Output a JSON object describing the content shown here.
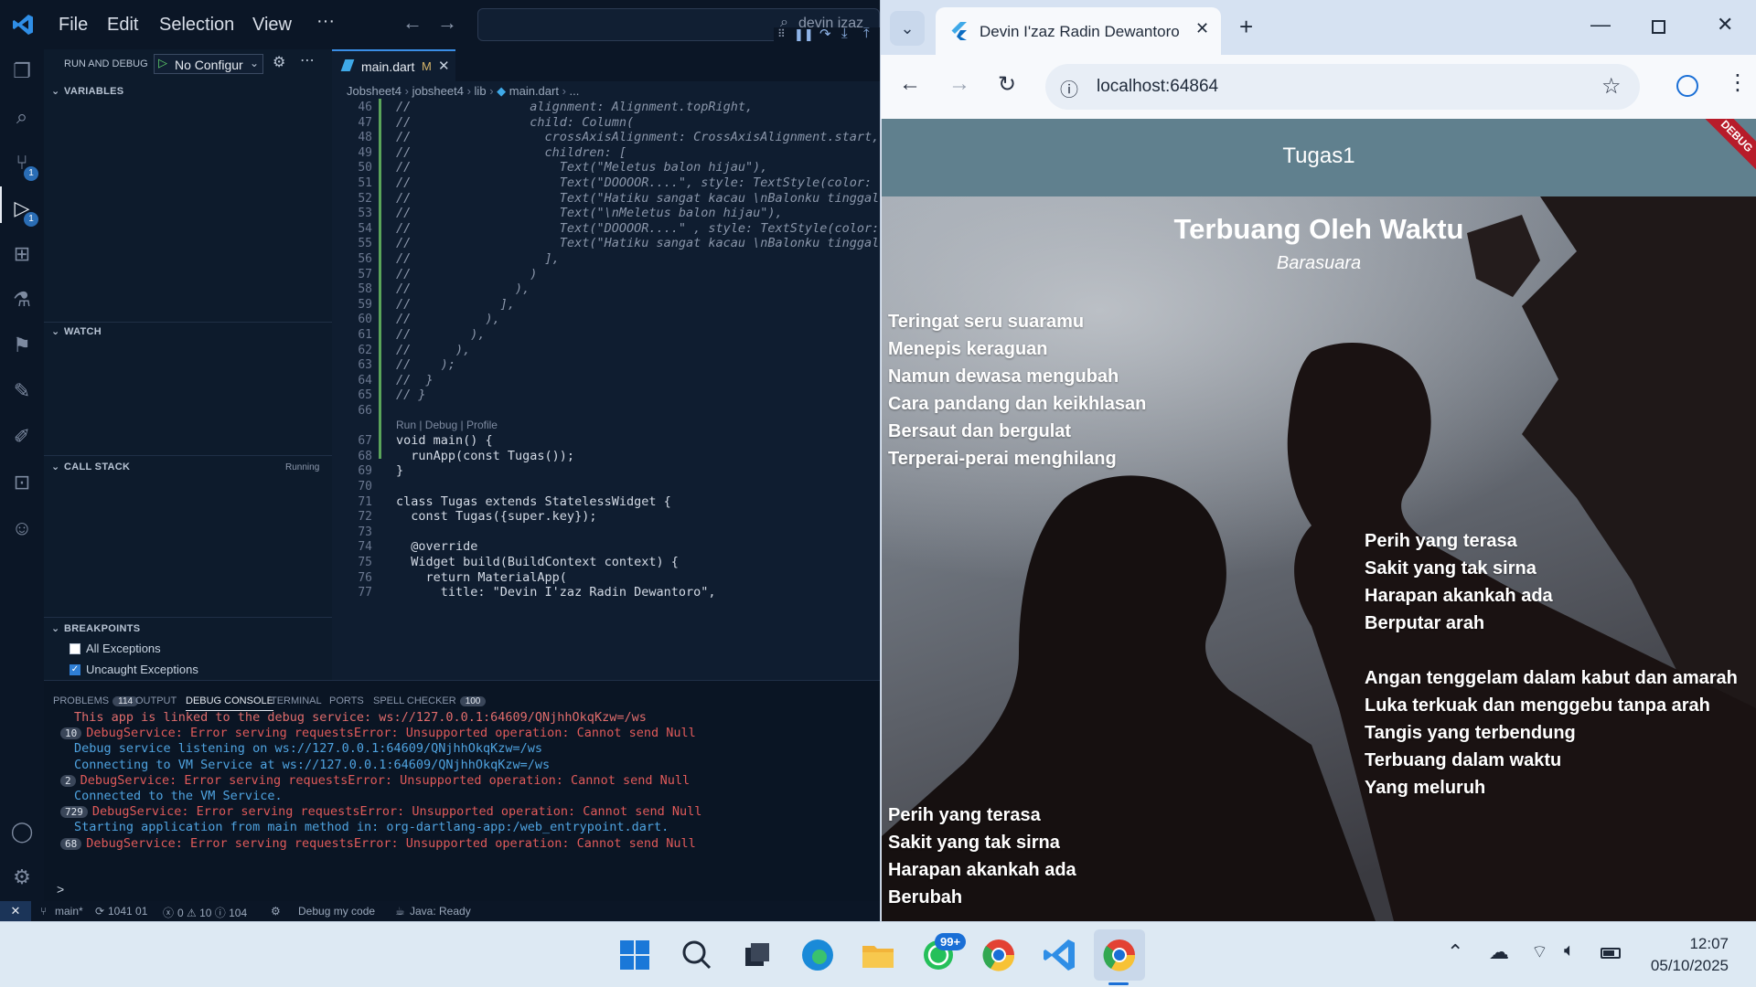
{
  "vscode": {
    "menu": [
      "File",
      "Edit",
      "Selection",
      "View",
      "···"
    ],
    "search_text": "devin izaz",
    "sidebar": {
      "run_debug_label": "RUN AND DEBUG",
      "config_select": "No Configur",
      "variables": "VARIABLES",
      "watch": "WATCH",
      "call_stack": "CALL STACK",
      "call_stack_status": "Running",
      "breakpoints": "BREAKPOINTS",
      "bp_all": "All Exceptions",
      "bp_uncaught": "Uncaught Exceptions"
    },
    "activity_badges": [
      "1",
      "1"
    ],
    "tab": {
      "label": "main.dart",
      "status": "M"
    },
    "breadcrumb": [
      "Jobsheet4",
      "jobsheet4",
      "lib",
      "main.dart",
      "..."
    ],
    "code_lines": [
      {
        "n": "46",
        "t": "//                alignment: Alignment.topRight,",
        "c": true
      },
      {
        "n": "47",
        "t": "//                child: Column(",
        "c": true
      },
      {
        "n": "48",
        "t": "//                  crossAxisAlignment: CrossAxisAlignment.start,",
        "c": true
      },
      {
        "n": "49",
        "t": "//                  children: [",
        "c": true
      },
      {
        "n": "50",
        "t": "//                    Text(\"Meletus balon hijau\"),",
        "c": true
      },
      {
        "n": "51",
        "t": "//                    Text(\"DOOOOR....\", style: TextStyle(color:",
        "c": true
      },
      {
        "n": "52",
        "t": "//                    Text(\"Hatiku sangat kacau \\nBalonku tinggal",
        "c": true
      },
      {
        "n": "53",
        "t": "//                    Text(\"\\nMeletus balon hijau\"),",
        "c": true
      },
      {
        "n": "54",
        "t": "//                    Text(\"DOOOOR....\" , style: TextStyle(color:",
        "c": true
      },
      {
        "n": "55",
        "t": "//                    Text(\"Hatiku sangat kacau \\nBalonku tinggal",
        "c": true
      },
      {
        "n": "56",
        "t": "//                  ],",
        "c": true
      },
      {
        "n": "57",
        "t": "//                )",
        "c": true
      },
      {
        "n": "58",
        "t": "//              ),",
        "c": true
      },
      {
        "n": "59",
        "t": "//            ],",
        "c": true
      },
      {
        "n": "60",
        "t": "//          ),",
        "c": true
      },
      {
        "n": "61",
        "t": "//        ),",
        "c": true
      },
      {
        "n": "62",
        "t": "//      ),",
        "c": true
      },
      {
        "n": "63",
        "t": "//    );",
        "c": true
      },
      {
        "n": "64",
        "t": "//  }",
        "c": true
      },
      {
        "n": "65",
        "t": "// }",
        "c": true
      },
      {
        "n": "66",
        "t": "",
        "c": false
      },
      {
        "n": "",
        "t": "Run | Debug | Profile",
        "c": false
      },
      {
        "n": "67",
        "t": "void main() {",
        "c": false
      },
      {
        "n": "68",
        "t": "  runApp(const Tugas());",
        "c": false
      },
      {
        "n": "69",
        "t": "}",
        "c": false
      },
      {
        "n": "70",
        "t": "",
        "c": false
      },
      {
        "n": "71",
        "t": "class Tugas extends StatelessWidget {",
        "c": false
      },
      {
        "n": "72",
        "t": "  const Tugas({super.key});",
        "c": false
      },
      {
        "n": "73",
        "t": "",
        "c": false
      },
      {
        "n": "74",
        "t": "  @override",
        "c": false
      },
      {
        "n": "75",
        "t": "  Widget build(BuildContext context) {",
        "c": false
      },
      {
        "n": "76",
        "t": "    return MaterialApp(",
        "c": false
      },
      {
        "n": "77",
        "t": "      title: \"Devin I'zaz Radin Dewantoro\",",
        "c": false
      }
    ],
    "panel_tabs": [
      {
        "label": "PROBLEMS",
        "badge": "114"
      },
      {
        "label": "OUTPUT",
        "badge": ""
      },
      {
        "label": "DEBUG CONSOLE",
        "badge": ""
      },
      {
        "label": "TERMINAL",
        "badge": ""
      },
      {
        "label": "PORTS",
        "badge": ""
      },
      {
        "label": "SPELL CHECKER",
        "badge": "100"
      }
    ],
    "console_lines": [
      {
        "badge": "",
        "text": "This app is linked to the debug service: ws://127.0.0.1:64609/QNjhhOkqKzw=/ws",
        "color": "#e06c6c"
      },
      {
        "badge": "10",
        "text": "DebugService: Error serving requestsError: Unsupported operation: Cannot send Null",
        "color": "#e05a5a"
      },
      {
        "badge": "",
        "text": "Debug service listening on ws://127.0.0.1:64609/QNjhhOkqKzw=/ws",
        "color": "#4fa3e0"
      },
      {
        "badge": "",
        "text": "Connecting to VM Service at ws://127.0.0.1:64609/QNjhhOkqKzw=/ws",
        "color": "#4fa3e0"
      },
      {
        "badge": "2",
        "text": "DebugService: Error serving requestsError: Unsupported operation: Cannot send Null",
        "color": "#e05a5a"
      },
      {
        "badge": "",
        "text": "Connected to the VM Service.",
        "color": "#4fa3e0"
      },
      {
        "badge": "729",
        "text": "DebugService: Error serving requestsError: Unsupported operation: Cannot send Null",
        "color": "#e05a5a"
      },
      {
        "badge": "",
        "text": "Starting application from main method in: org-dartlang-app:/web_entrypoint.dart.",
        "color": "#4fa3e0"
      },
      {
        "badge": "68",
        "text": "DebugService: Error serving requestsError: Unsupported operation: Cannot send Null",
        "color": "#e05a5a"
      }
    ],
    "console_prompt": ">",
    "status": {
      "branch": "main*",
      "sync": "1041 01",
      "problems": "0 ⚠ 10 ⓘ 104",
      "debug": "Debug my code",
      "java": "Java: Ready"
    }
  },
  "chrome": {
    "tab_title": "Devin I'zaz Radin Dewantoro",
    "url": "localhost:64864",
    "app_title": "Tugas1",
    "debug_banner": "DEBUG",
    "song_title": "Terbuang Oleh Waktu",
    "artist": "Barasuara",
    "verse1": "Teringat seru suaramu\nMenepis keraguan\nNamun dewasa mengubah\nCara pandang dan keikhlasan\nBersaut dan bergulat\nTerperai-perai menghilang",
    "verse2": "Perih yang terasa\nSakit yang tak sirna\nHarapan akankah ada\nBerputar arah\n\nAngan tenggelam dalam kabut dan amarah\nLuka terkuak dan menggebu tanpa arah\nTangis yang terbendung\nTerbuang dalam waktu\nYang meluruh",
    "verse3": "Perih yang terasa\nSakit yang tak sirna\nHarapan akankah ada\nBerubah"
  },
  "taskbar": {
    "whatsapp_badge": "99+",
    "time": "12:07",
    "date": "05/10/2025"
  },
  "colors": {
    "appbar": "#60808e",
    "vscode_bg": "#0d1b2c",
    "accent": "#3a8ee6"
  }
}
